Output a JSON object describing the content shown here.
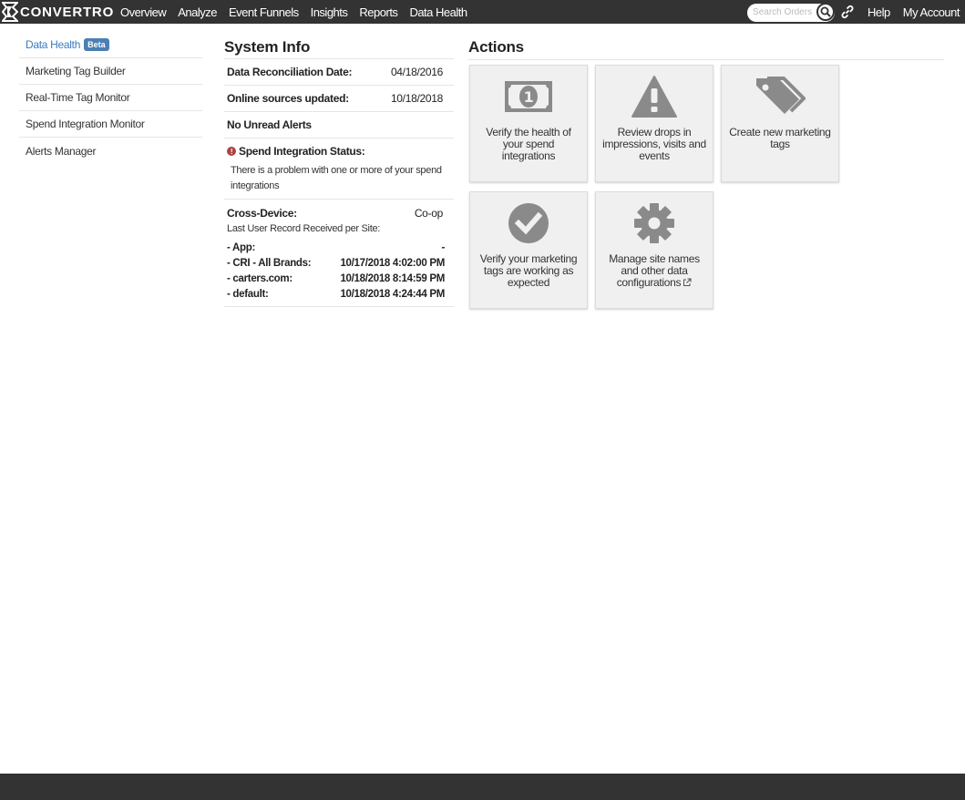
{
  "nav": {
    "brand": "CONVERTRO",
    "items": [
      "Overview",
      "Analyze",
      "Event Funnels",
      "Insights",
      "Reports",
      "Data Health"
    ],
    "search_placeholder": "Search Orders",
    "help": "Help",
    "account": "My Account"
  },
  "sidebar": {
    "items": [
      {
        "label": "Data Health",
        "badge": "Beta"
      },
      {
        "label": "Marketing Tag Builder"
      },
      {
        "label": "Real-Time Tag Monitor"
      },
      {
        "label": "Spend Integration Monitor"
      },
      {
        "label": "Alerts Manager"
      }
    ]
  },
  "system_info": {
    "title": "System Info",
    "reconciliation_label": "Data Reconciliation Date:",
    "reconciliation_value": "04/18/2016",
    "online_label": "Online sources updated:",
    "online_value": "10/18/2018",
    "alerts": "No Unread Alerts",
    "spend_status_label": "Spend Integration Status:",
    "spend_status_msg": "There is a problem with one or more of your spend integrations",
    "cross_device_label": "Cross-Device:",
    "cross_device_value": "Co-op",
    "last_record_label": "Last User Record Received per Site:",
    "sites": [
      {
        "label": "- App:",
        "value": "-"
      },
      {
        "label": "- CRI - All Brands:",
        "value": "10/17/2018 4:02:00 PM"
      },
      {
        "label": "- carters.com:",
        "value": "10/18/2018 8:14:59 PM"
      },
      {
        "label": "- default:",
        "value": "10/18/2018 4:24:44 PM"
      }
    ]
  },
  "actions": {
    "title": "Actions",
    "cards": [
      {
        "text": "Verify the health of your spend integrations",
        "icon": "money-icon"
      },
      {
        "text": "Review drops in impressions, visits and events",
        "icon": "warning-icon"
      },
      {
        "text": "Create new marketing tags",
        "icon": "tags-icon"
      },
      {
        "text": "Verify your marketing tags are working as expected",
        "icon": "check-circle-icon"
      },
      {
        "text": "Manage site names and other data configurations",
        "icon": "gear-icon"
      }
    ]
  }
}
